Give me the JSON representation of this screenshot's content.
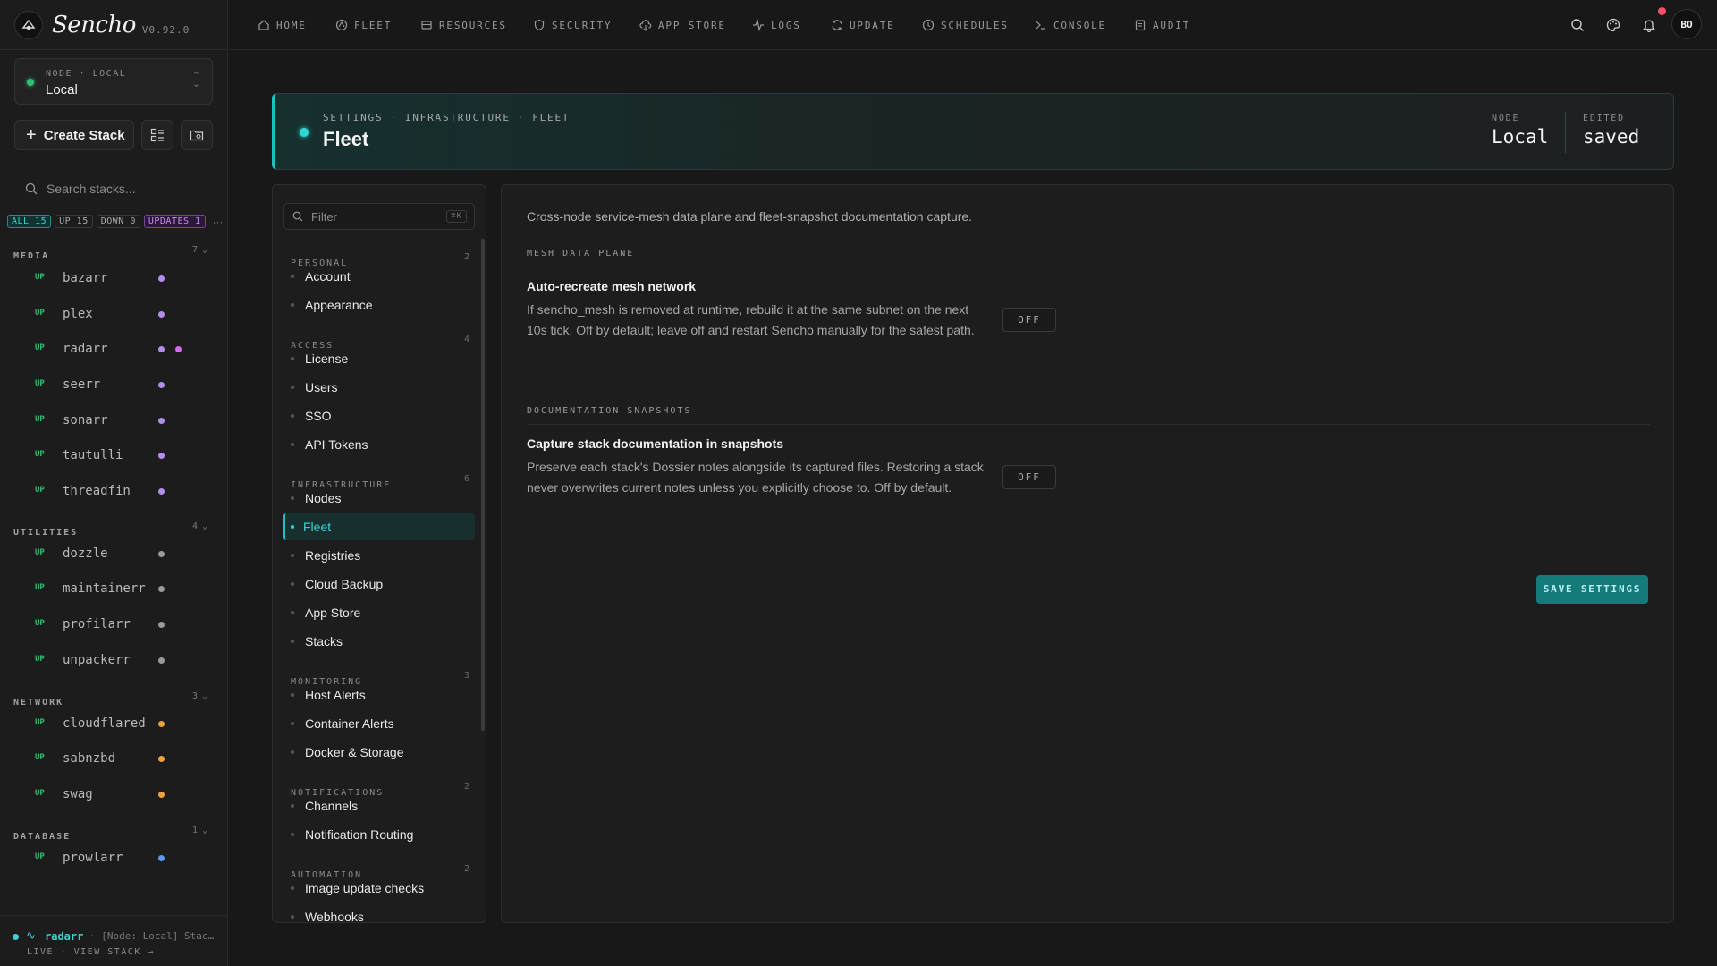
{
  "brand": {
    "name": "Sencho",
    "version": "V0.92.0"
  },
  "node_selector": {
    "kicker": "NODE · LOCAL",
    "value": "Local"
  },
  "sidebar": {
    "create_stack_label": "Create Stack",
    "search_placeholder": "Search stacks...",
    "filters": [
      {
        "label": "ALL 15"
      },
      {
        "label": "UP 15"
      },
      {
        "label": "DOWN 0"
      },
      {
        "label": "UPDATES 1"
      }
    ],
    "filters_more": "···",
    "groups": [
      {
        "label": "MEDIA",
        "count": "7"
      },
      {
        "label": "UTILITIES",
        "count": "4"
      },
      {
        "label": "NETWORK",
        "count": "3"
      },
      {
        "label": "DATABASE",
        "count": "1"
      }
    ],
    "stacks": [
      {
        "status": "UP",
        "name": "bazarr",
        "dot": "#b48cf0"
      },
      {
        "status": "UP",
        "name": "plex",
        "dot": "#b48cf0"
      },
      {
        "status": "UP",
        "name": "radarr",
        "dot": "#b48cf0",
        "dot2": "#d46cf0"
      },
      {
        "status": "UP",
        "name": "seerr",
        "dot": "#b48cf0"
      },
      {
        "status": "UP",
        "name": "sonarr",
        "dot": "#b48cf0"
      },
      {
        "status": "UP",
        "name": "tautulli",
        "dot": "#b48cf0"
      },
      {
        "status": "UP",
        "name": "threadfin",
        "dot": "#b48cf0"
      },
      {
        "status": "UP",
        "name": "dozzle",
        "dot": "#9a9a9a"
      },
      {
        "status": "UP",
        "name": "maintainerr",
        "dot": "#9a9a9a"
      },
      {
        "status": "UP",
        "name": "profilarr",
        "dot": "#9a9a9a"
      },
      {
        "status": "UP",
        "name": "unpackerr",
        "dot": "#9a9a9a"
      },
      {
        "status": "UP",
        "name": "cloudflared",
        "dot": "#f0a040"
      },
      {
        "status": "UP",
        "name": "sabnzbd",
        "dot": "#f0a040"
      },
      {
        "status": "UP",
        "name": "swag",
        "dot": "#f0a040"
      },
      {
        "status": "UP",
        "name": "prowlarr",
        "dot": "#5a9af0"
      }
    ],
    "live": {
      "stack": "radarr",
      "message": "· [Node: Local] Stack updated",
      "link": "LIVE · VIEW STACK →"
    }
  },
  "topnav": {
    "items": [
      "HOME",
      "FLEET",
      "RESOURCES",
      "SECURITY",
      "APP STORE",
      "LOGS",
      "UPDATE",
      "SCHEDULES",
      "CONSOLE",
      "AUDIT"
    ],
    "avatar": "BO"
  },
  "header": {
    "breadcrumb": [
      "SETTINGS",
      "INFRASTRUCTURE",
      "FLEET"
    ],
    "breadcrumb_sep": "·",
    "title": "Fleet",
    "node_kicker": "NODE",
    "node_value": "Local",
    "edited_kicker": "EDITED",
    "edited_value": "saved"
  },
  "settings_nav": {
    "filter_placeholder": "Filter",
    "filter_shortcut": "⌘K",
    "sections": [
      {
        "label": "PERSONAL",
        "count": "2"
      },
      {
        "label": "ACCESS",
        "count": "4"
      },
      {
        "label": "INFRASTRUCTURE",
        "count": "6"
      },
      {
        "label": "MONITORING",
        "count": "3"
      },
      {
        "label": "NOTIFICATIONS",
        "count": "2"
      },
      {
        "label": "AUTOMATION",
        "count": "2"
      }
    ],
    "links": [
      "Account",
      "Appearance",
      "License",
      "Users",
      "SSO",
      "API Tokens",
      "Nodes",
      "Fleet",
      "Registries",
      "Cloud Backup",
      "App Store",
      "Stacks",
      "Host Alerts",
      "Container Alerts",
      "Docker & Storage",
      "Channels",
      "Notification Routing",
      "Image update checks",
      "Webhooks"
    ],
    "active": "Fleet"
  },
  "content": {
    "description": "Cross-node service-mesh data plane and fleet-snapshot documentation capture.",
    "sections": [
      {
        "label": "MESH DATA PLANE",
        "title": "Auto-recreate mesh network",
        "description": "If sencho_mesh is removed at runtime, rebuild it at the same subnet on the next 10s tick. Off by default; leave off and restart Sencho manually for the safest path.",
        "toggle": "OFF"
      },
      {
        "label": "DOCUMENTATION SNAPSHOTS",
        "title": "Capture stack documentation in snapshots",
        "description": "Preserve each stack's Dossier notes alongside its captured files. Restoring a stack never overwrites current notes unless you explicitly choose to. Off by default.",
        "toggle": "OFF"
      }
    ],
    "save_label": "SAVE SETTINGS"
  },
  "colors": {
    "accent": "#1fbfbf",
    "up": "#2fbf71",
    "notification": "#ff4d6a"
  }
}
